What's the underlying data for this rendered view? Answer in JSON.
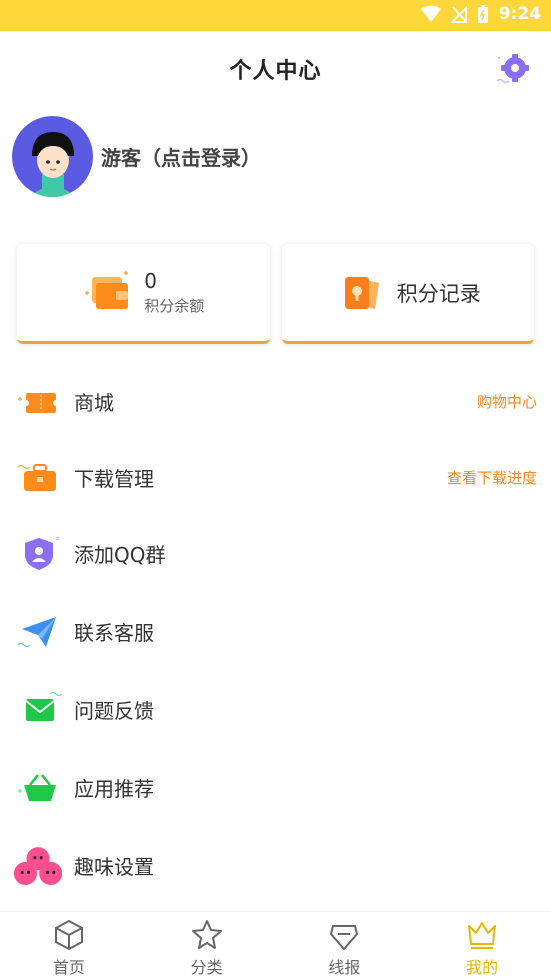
{
  "status": {
    "time": "9:24"
  },
  "header": {
    "title": "个人中心"
  },
  "profile": {
    "name": "游客（点击登录）"
  },
  "cards": {
    "points_value": "0",
    "points_label": "积分余额",
    "record_label": "积分记录"
  },
  "menu": [
    {
      "label": "商城",
      "right": "购物中心"
    },
    {
      "label": "下载管理",
      "right": "查看下载进度"
    },
    {
      "label": "添加QQ群"
    },
    {
      "label": "联系客服"
    },
    {
      "label": "问题反馈"
    },
    {
      "label": "应用推荐"
    },
    {
      "label": "趣味设置"
    }
  ],
  "tabs": [
    {
      "label": "首页"
    },
    {
      "label": "分类"
    },
    {
      "label": "线报"
    },
    {
      "label": "我的"
    }
  ],
  "colors": {
    "accent": "#ffd73a",
    "orange": "#f08a1c",
    "active_tab": "#e8b800"
  }
}
